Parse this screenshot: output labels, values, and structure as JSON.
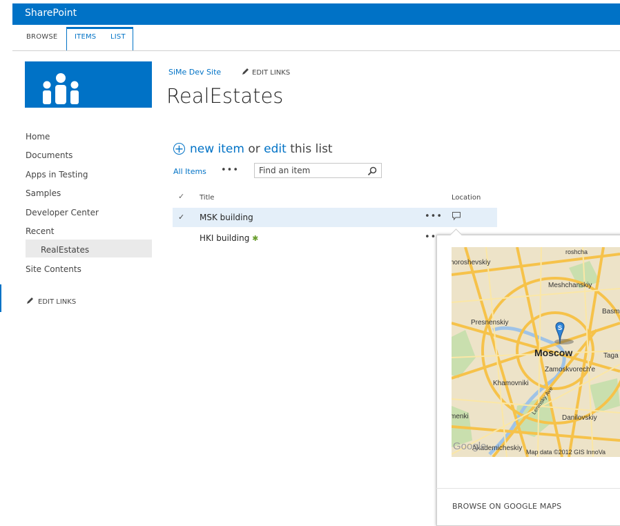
{
  "suite_bar": {
    "brand": "SharePoint",
    "accent": "#0072c6"
  },
  "ribbon": {
    "tabs": [
      "BROWSE",
      "ITEMS",
      "LIST"
    ]
  },
  "header": {
    "site_link": "SiMe Dev Site",
    "edit_links": "EDIT LINKS",
    "page_title": "RealEstates"
  },
  "left_nav": {
    "items": [
      "Home",
      "Documents",
      "Apps in Testing",
      "Samples",
      "Developer Center",
      "Recent",
      "RealEstates",
      "Site Contents"
    ],
    "selected": "RealEstates",
    "edit_links": "EDIT LINKS"
  },
  "list": {
    "new_item": "new item",
    "or": "or",
    "edit": "edit",
    "this_list": "this list",
    "view_name": "All Items",
    "view_more": "•••",
    "search_placeholder": "Find an item",
    "columns": {
      "check": "✓",
      "title": "Title",
      "location": "Location"
    },
    "rows": [
      {
        "title": "MSK building",
        "checked": "✓",
        "menu": "•••"
      },
      {
        "title": "HKI building",
        "badge": "✱",
        "menu": "•••"
      }
    ]
  },
  "map_callout": {
    "labels": [
      "roshcha",
      "horoshevskiy",
      "Meshchanskiy",
      "Basmar",
      "Presnenskiy",
      "Moscow",
      "Taga",
      "Zamoskvorech'e",
      "Khamovniki",
      "Leninsky Ave",
      "menki",
      "Danilovskiy",
      "Akademicheskiy",
      "Map data ©2012 GIS InnoVa",
      "Google"
    ],
    "marker": "S",
    "action": "BROWSE ON GOOGLE MAPS"
  }
}
